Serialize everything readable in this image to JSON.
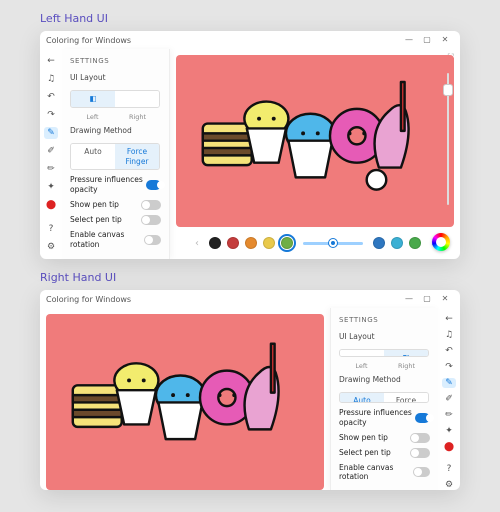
{
  "captions": {
    "left": "Left Hand UI",
    "right": "Right Hand UI"
  },
  "window": {
    "title": "Coloring for Windows",
    "controls": {
      "min": "—",
      "max": "▢",
      "close": "✕"
    }
  },
  "tools": {
    "items": [
      {
        "name": "back",
        "glyph": "←"
      },
      {
        "name": "music",
        "glyph": "♫"
      },
      {
        "name": "undo",
        "glyph": "↶"
      },
      {
        "name": "redo",
        "glyph": "↷"
      },
      {
        "name": "brush",
        "glyph": "✎",
        "selected": true
      },
      {
        "name": "pencil",
        "glyph": "✐"
      },
      {
        "name": "marker",
        "glyph": "✏"
      },
      {
        "name": "dropper",
        "glyph": "✦"
      },
      {
        "name": "palette",
        "glyph": "⬤"
      }
    ],
    "bottom": [
      {
        "name": "help",
        "glyph": "?"
      },
      {
        "name": "settings",
        "glyph": "⚙"
      }
    ]
  },
  "settings": {
    "header": "SETTINGS",
    "ui_layout": {
      "label": "UI Layout",
      "left": "Left",
      "right": "Right",
      "slider_glyph": "◧"
    },
    "drawing_method": {
      "label": "Drawing Method",
      "auto": "Auto",
      "force_finger": "Force Finger"
    },
    "toggles": {
      "pressure": {
        "label": "Pressure influences opacity",
        "on": true
      },
      "show_tip": {
        "label": "Show pen tip",
        "on": false
      },
      "select_tip": {
        "label": "Select pen tip",
        "on": false
      },
      "rotation": {
        "label": "Enable canvas rotation",
        "on": false
      }
    },
    "selected_method_left": "force_finger",
    "selected_method_right": "auto",
    "selected_layout_left": "left",
    "selected_layout_right": "right"
  },
  "canvas": {
    "bg": "#f07b7b",
    "expand_glyph": "⛶"
  },
  "palette": {
    "prev": "‹",
    "next": "›",
    "colors": [
      "#222222",
      "#c43c3c",
      "#e58a2e",
      "#e9c94b",
      "#6fae45",
      "#3aa26e",
      "#2e77c0",
      "#3bb0d4",
      "#49a94b",
      "#4b3aa2"
    ],
    "selected_index": 4
  }
}
